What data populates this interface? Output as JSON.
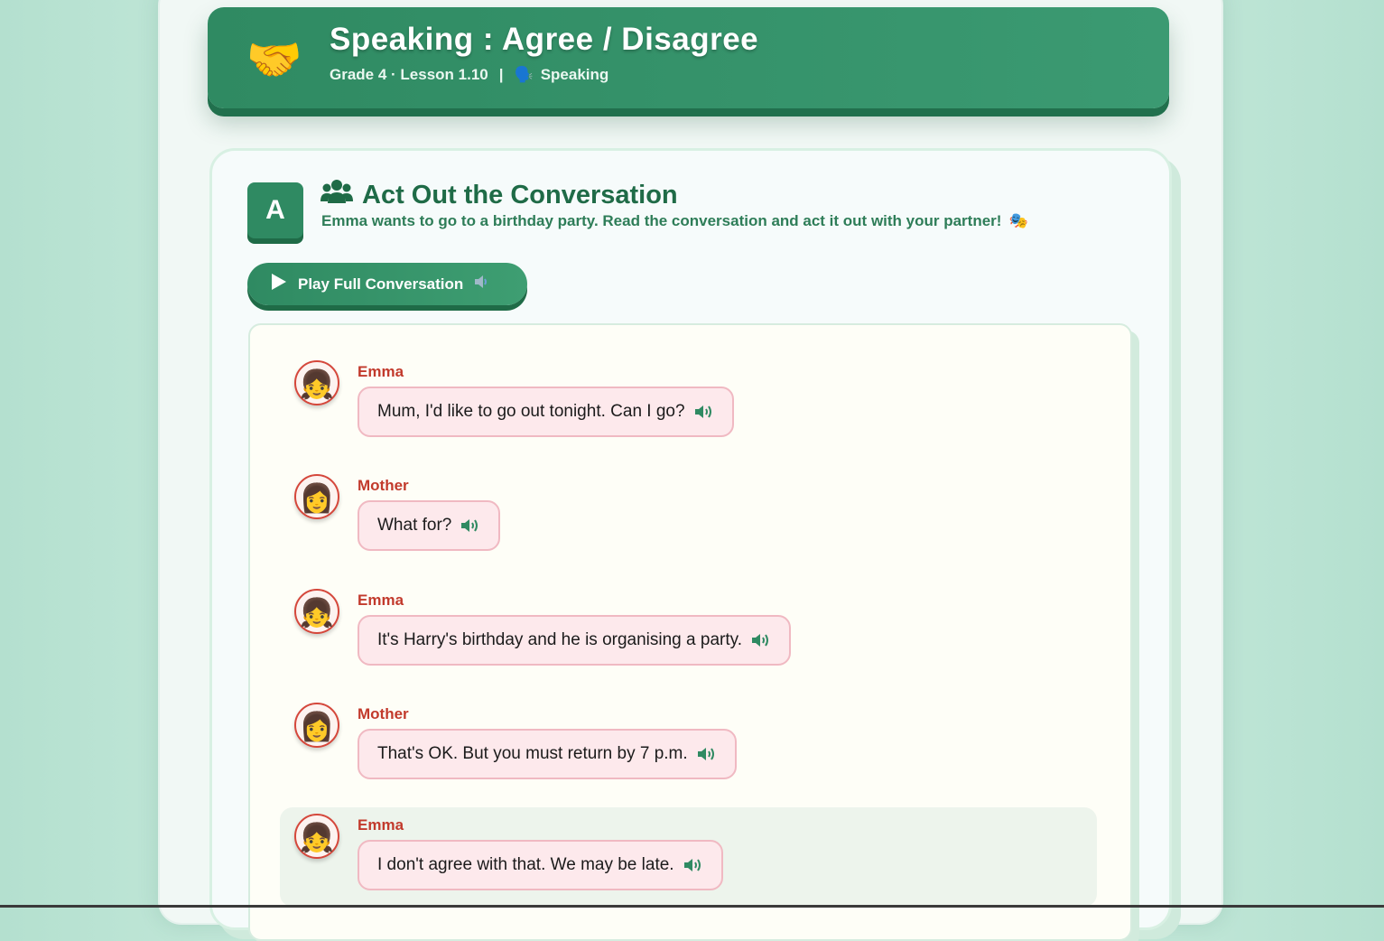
{
  "header": {
    "icon": "handshake-icon",
    "title": "Speaking : Agree / Disagree",
    "grade_lesson": "Grade 4 · Lesson 1.10",
    "separator": "|",
    "skill_icon": "speaking-head-icon",
    "skill": "Speaking"
  },
  "section": {
    "badge": "A",
    "icon": "people-group-icon",
    "title": "Act Out the Conversation",
    "description": "Emma wants to go to a birthday party. Read the conversation and act it out with your partner!",
    "desc_icon": "theater-masks-icon"
  },
  "play_button": {
    "label": "Play Full Conversation",
    "icon": "play-icon",
    "end_icon": "speaker-icon"
  },
  "conversation": [
    {
      "speaker": "Emma",
      "avatar": "girl-icon",
      "text": "Mum, I'd like to go out tonight. Can I go?"
    },
    {
      "speaker": "Mother",
      "avatar": "woman-icon",
      "text": "What for?"
    },
    {
      "speaker": "Emma",
      "avatar": "girl-icon",
      "text": "It's Harry's birthday and he is organising a party."
    },
    {
      "speaker": "Mother",
      "avatar": "woman-icon",
      "text": "That's OK. But you must return by 7 p.m."
    },
    {
      "speaker": "Emma",
      "avatar": "girl-icon",
      "text": "I don't agree with that. We may be late."
    }
  ],
  "colors": {
    "primary": "#2f8a62",
    "speaker_name": "#c23a2c",
    "bubble_bg": "#fde9ec",
    "bubble_border": "#f0b9c2",
    "active_row": "#edf4ec"
  }
}
